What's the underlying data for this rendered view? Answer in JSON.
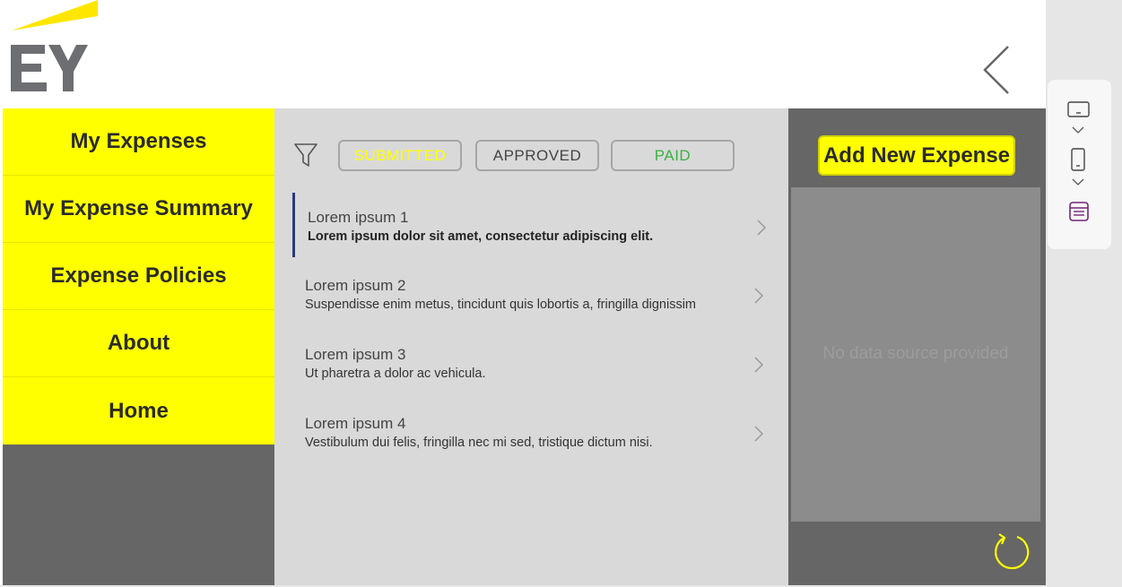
{
  "brand": {
    "logo_text": "EY",
    "accent": "#ffff00",
    "dark": "#666666"
  },
  "header": {
    "back_icon": "chevron-left-icon"
  },
  "sidebar": {
    "items": [
      {
        "label": "My Expenses"
      },
      {
        "label": "My Expense Summary"
      },
      {
        "label": "Expense Policies"
      },
      {
        "label": "About"
      },
      {
        "label": "Home"
      }
    ]
  },
  "filters": {
    "icon": "filter-icon",
    "statuses": [
      {
        "label": "SUBMITTED",
        "color": "#ffff00"
      },
      {
        "label": "APPROVED",
        "color": "#444444"
      },
      {
        "label": "PAID",
        "color": "#3cb043"
      }
    ]
  },
  "list": {
    "items": [
      {
        "title": "Lorem ipsum 1",
        "subtitle": "Lorem ipsum dolor sit amet, consectetur adipiscing elit.",
        "selected": true
      },
      {
        "title": "Lorem ipsum 2",
        "subtitle": "Suspendisse enim metus, tincidunt quis lobortis a, fringilla dignissim",
        "selected": false
      },
      {
        "title": "Lorem ipsum 3",
        "subtitle": "Ut pharetra a dolor ac vehicula.",
        "selected": false
      },
      {
        "title": "Lorem ipsum 4",
        "subtitle": "Vestibulum dui felis, fringilla nec mi sed, tristique dictum nisi.",
        "selected": false
      }
    ]
  },
  "right_panel": {
    "add_button_label": "Add New Expense",
    "gallery_empty_text": "No data source provided",
    "refresh_icon": "refresh-icon"
  },
  "toolbar": {
    "icons": [
      "tablet-landscape-icon",
      "chevron-down-icon",
      "phone-icon",
      "chevron-down-icon",
      "form-icon"
    ]
  }
}
